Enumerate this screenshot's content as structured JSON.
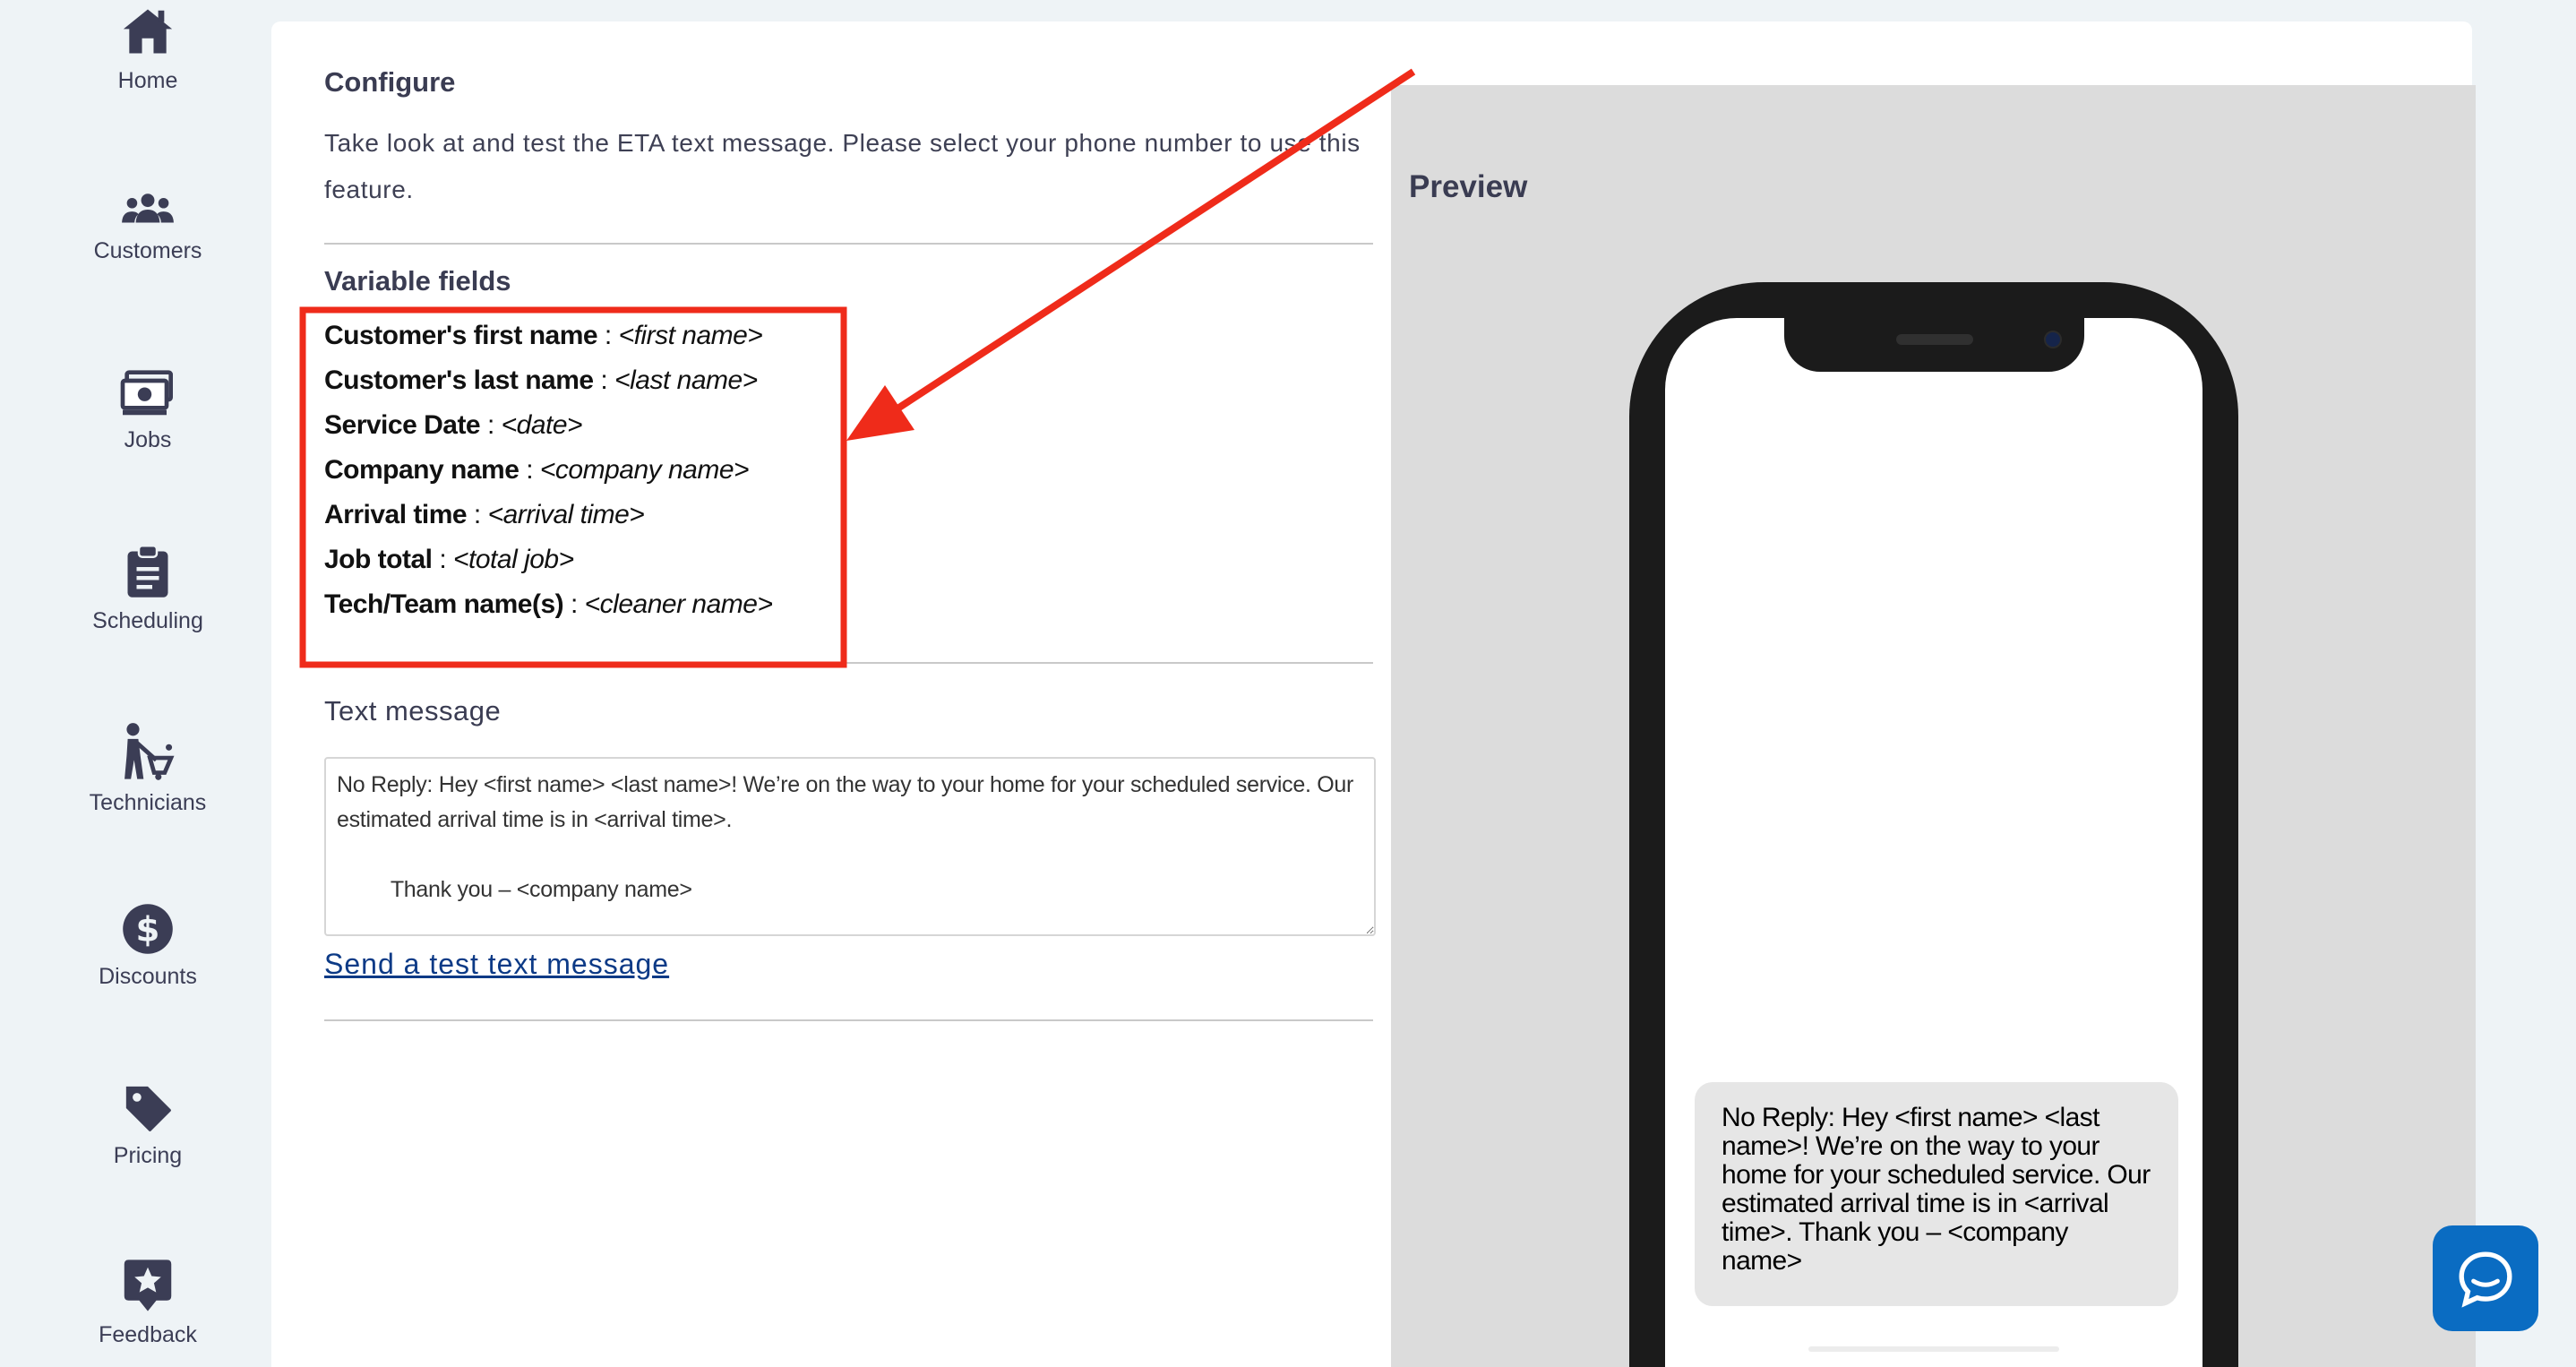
{
  "sidebar": {
    "items": [
      {
        "label": "Home",
        "icon": "home-icon"
      },
      {
        "label": "Customers",
        "icon": "customers-icon"
      },
      {
        "label": "Jobs",
        "icon": "jobs-icon"
      },
      {
        "label": "Scheduling",
        "icon": "clipboard-icon"
      },
      {
        "label": "Technicians",
        "icon": "technician-icon"
      },
      {
        "label": "Discounts",
        "icon": "dollar-icon"
      },
      {
        "label": "Pricing",
        "icon": "tag-icon"
      },
      {
        "label": "Feedback",
        "icon": "feedback-icon"
      }
    ]
  },
  "configure": {
    "title": "Configure",
    "description": "Take look at and test the ETA text message. Please select your phone number to use this feature."
  },
  "variable_fields": {
    "title": "Variable fields",
    "items": [
      {
        "label": "Customer's first name",
        "sep": " : ",
        "token": "<first name>"
      },
      {
        "label": "Customer's last name",
        "sep": " : ",
        "token": "<last name>"
      },
      {
        "label": "Service Date",
        "sep": " : ",
        "token": "<date>"
      },
      {
        "label": "Company name",
        "sep": " : ",
        "token": "<company name>"
      },
      {
        "label": "Arrival time",
        "sep": " : ",
        "token": "<arrival time>"
      },
      {
        "label": "Job total",
        "sep": " : ",
        "token": "<total job>"
      },
      {
        "label": "Tech/Team name(s)",
        "sep": " : ",
        "token": "<cleaner name>"
      }
    ]
  },
  "text_message": {
    "title": "Text message",
    "value": "No Reply: Hey <first name> <last name>! We’re on the way to your home for your scheduled service. Our estimated arrival time is in <arrival time>.\n\n         Thank you – <company name>",
    "send_test_link": "Send a test text message"
  },
  "preview": {
    "title": "Preview",
    "bubble_text": "No Reply: Hey <first name> <last name>! We’re on the way to your home for your scheduled service. Our estimated arrival time is in <arrival time>. Thank you – <company name>"
  },
  "colors": {
    "background": "#eef3f6",
    "sidebar_icon": "#3b3d55",
    "link": "#0c3a86",
    "annotation": "#ef2b1a",
    "chat_button": "#0a6cc2",
    "preview_bg": "#dcdcdc"
  },
  "chat": {
    "icon": "chat-bubble-icon"
  }
}
